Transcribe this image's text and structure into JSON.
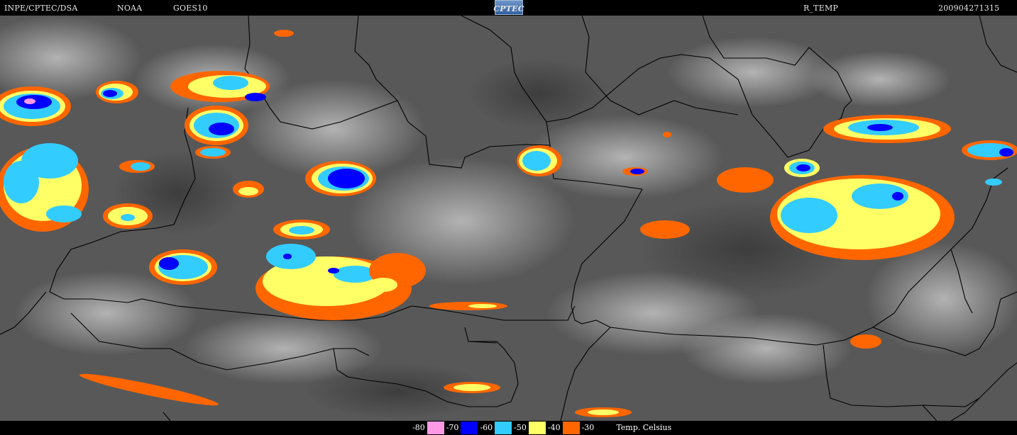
{
  "header": {
    "agency": "INPE/CPTEC/DSA",
    "provider": "NOAA",
    "satellite": "GOES10",
    "logo_text": "CPTEC",
    "product": "R_TEMP",
    "timestamp": "200904271315"
  },
  "legend": {
    "units": "Temp. Celsius",
    "items": [
      {
        "label": "-80",
        "color": "#ff99e6"
      },
      {
        "label": "-70",
        "color": "#0000ff"
      },
      {
        "label": "-60",
        "color": "#33ccff"
      },
      {
        "label": "-50",
        "color": "#ffff66"
      },
      {
        "label": "-40",
        "color": "#ff6600"
      },
      {
        "label": "-30",
        "color": "#000000"
      }
    ]
  },
  "map": {
    "background": "#5a5a5a",
    "border_color": "#000000"
  }
}
